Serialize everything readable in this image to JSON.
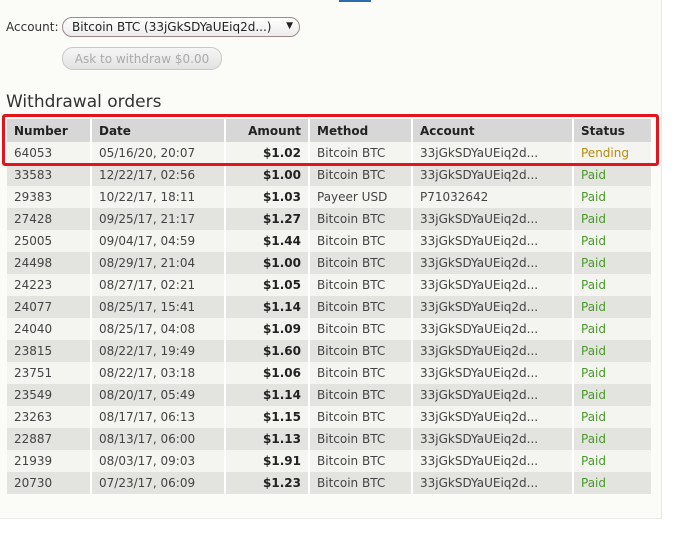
{
  "account": {
    "label": "Account:",
    "selected": "Bitcoin BTC (33jGkSDYaUEiq2d...)"
  },
  "withdraw_button": "Ask to withdraw $0.00",
  "section_title": "Withdrawal orders",
  "table": {
    "headers": [
      "Number",
      "Date",
      "Amount",
      "Method",
      "Account",
      "Status"
    ],
    "rows": [
      [
        "64053",
        "05/16/20, 20:07",
        "$1.02",
        "Bitcoin BTC",
        "33jGkSDYaUEiq2d...",
        "Pending"
      ],
      [
        "33583",
        "12/22/17, 02:56",
        "$1.00",
        "Bitcoin BTC",
        "33jGkSDYaUEiq2d...",
        "Paid"
      ],
      [
        "29383",
        "10/22/17, 18:11",
        "$1.03",
        "Payeer USD",
        "P71032642",
        "Paid"
      ],
      [
        "27428",
        "09/25/17, 21:17",
        "$1.27",
        "Bitcoin BTC",
        "33jGkSDYaUEiq2d...",
        "Paid"
      ],
      [
        "25005",
        "09/04/17, 04:59",
        "$1.44",
        "Bitcoin BTC",
        "33jGkSDYaUEiq2d...",
        "Paid"
      ],
      [
        "24498",
        "08/29/17, 21:04",
        "$1.00",
        "Bitcoin BTC",
        "33jGkSDYaUEiq2d...",
        "Paid"
      ],
      [
        "24223",
        "08/27/17, 02:21",
        "$1.05",
        "Bitcoin BTC",
        "33jGkSDYaUEiq2d...",
        "Paid"
      ],
      [
        "24077",
        "08/25/17, 15:41",
        "$1.14",
        "Bitcoin BTC",
        "33jGkSDYaUEiq2d...",
        "Paid"
      ],
      [
        "24040",
        "08/25/17, 04:08",
        "$1.09",
        "Bitcoin BTC",
        "33jGkSDYaUEiq2d...",
        "Paid"
      ],
      [
        "23815",
        "08/22/17, 19:49",
        "$1.60",
        "Bitcoin BTC",
        "33jGkSDYaUEiq2d...",
        "Paid"
      ],
      [
        "23751",
        "08/22/17, 03:18",
        "$1.06",
        "Bitcoin BTC",
        "33jGkSDYaUEiq2d...",
        "Paid"
      ],
      [
        "23549",
        "08/20/17, 05:49",
        "$1.14",
        "Bitcoin BTC",
        "33jGkSDYaUEiq2d...",
        "Paid"
      ],
      [
        "23263",
        "08/17/17, 06:13",
        "$1.15",
        "Bitcoin BTC",
        "33jGkSDYaUEiq2d...",
        "Paid"
      ],
      [
        "22887",
        "08/13/17, 06:00",
        "$1.13",
        "Bitcoin BTC",
        "33jGkSDYaUEiq2d...",
        "Paid"
      ],
      [
        "21939",
        "08/03/17, 09:03",
        "$1.91",
        "Bitcoin BTC",
        "33jGkSDYaUEiq2d...",
        "Paid"
      ],
      [
        "20730",
        "07/23/17, 06:09",
        "$1.23",
        "Bitcoin BTC",
        "33jGkSDYaUEiq2d...",
        "Paid"
      ]
    ]
  },
  "colors": {
    "paid": "#4a9a2a",
    "pending": "#b88a10",
    "highlight": "#e3141c"
  }
}
